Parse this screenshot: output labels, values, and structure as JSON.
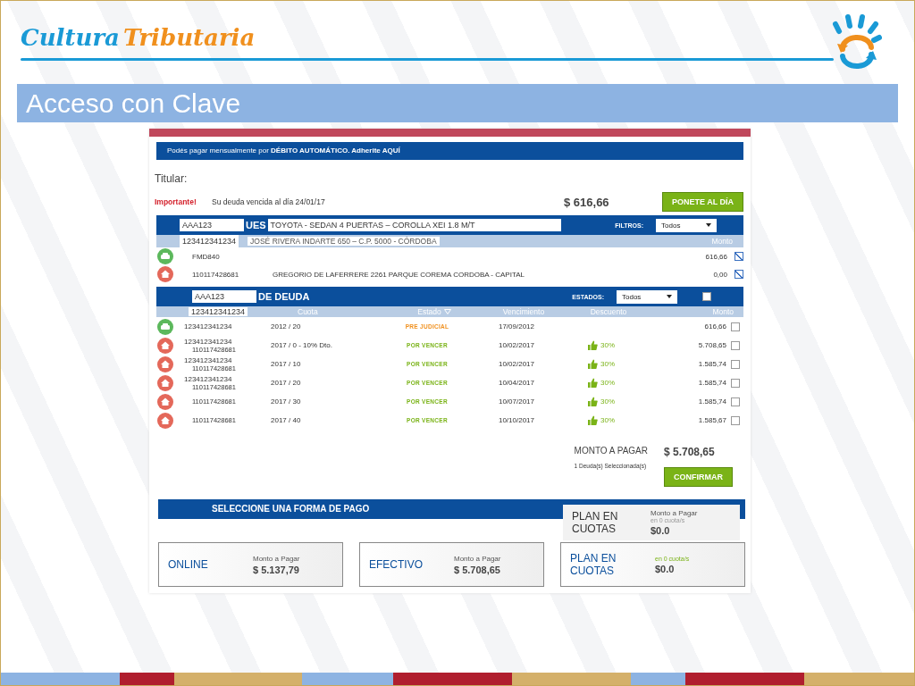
{
  "slide": {
    "brand": {
      "first": "Cultura",
      "second": "Tributaria"
    },
    "title": "Acceso con Clave"
  },
  "banner": {
    "text": "Podés pagar mensualmente por **DÉBITO AUTOMÁTICO. Adherite AQUÍ**"
  },
  "titular": {
    "label": "Titular:"
  },
  "notice": {
    "tag": "Importante!",
    "text": "Su deuda vencida al día 24/01/17",
    "amount": "$ 616,66",
    "button": "PONETE AL DÍA"
  },
  "objects": {
    "tag": "AAA123",
    "heading_fragment": "UES",
    "description": "TOYOTA -  SEDAN 4 PUERTAS – COROLLA XEI 1.8 M/T",
    "filter_label": "FILTROS:",
    "filter_value": "Todos",
    "sub_tag": "123412341234",
    "address": "JOSÉ RIVERA INDARTE 650 – C.P. 5000 - CÓRDOBA",
    "column": "Monto",
    "rows": [
      {
        "kind": "vehicle",
        "id": "FMD840",
        "amount": "616,66",
        "checked": true
      },
      {
        "kind": "property",
        "id": "110117428681",
        "address": "GREGORIO DE LAFERRERE 2261 PARQUE COREMA CORDOBA - CAPITAL",
        "amount": "0,00",
        "checked": true
      }
    ]
  },
  "debts": {
    "tag": "AAA123",
    "heading_fragment": "DE DEUDA",
    "filter_label": "ESTADOS:",
    "filter_value": "Todos",
    "all_checked": false,
    "columns": [
      "Cuota",
      "Estado",
      "Vencimiento",
      "Descuento",
      "Monto"
    ],
    "header_tag": "123412341234",
    "rows": [
      {
        "kind": "vehicle",
        "tag": "123412341234",
        "cuota": "2012 / 20",
        "estado": "PRE JUDICIAL",
        "color": "#f0901e",
        "vencimiento": "17/09/2012",
        "monto": "616,66",
        "checked": false
      },
      {
        "kind": "property",
        "tag": "123412341234",
        "id": "110117428681",
        "cuota": "2017 / 0 - 10% Dto.",
        "estado": "POR VENCER",
        "color": "#7ab317",
        "vencimiento": "10/02/2017",
        "descuento": "30%",
        "monto": "5.708,65",
        "checked": false
      },
      {
        "kind": "property",
        "tag": "123412341234",
        "id": "110117428681",
        "cuota": "2017 / 10",
        "estado": "POR VENCER",
        "color": "#7ab317",
        "vencimiento": "10/02/2017",
        "descuento": "30%",
        "monto": "1.585,74",
        "checked": false
      },
      {
        "kind": "property",
        "tag": "123412341234",
        "id": "110117428681",
        "cuota": "2017 / 20",
        "estado": "POR VENCER",
        "color": "#7ab317",
        "vencimiento": "10/04/2017",
        "descuento": "30%",
        "monto": "1.585,74",
        "checked": false
      },
      {
        "kind": "property",
        "id": "110117428681",
        "cuota": "2017 / 30",
        "estado": "POR VENCER",
        "color": "#7ab317",
        "vencimiento": "10/07/2017",
        "descuento": "30%",
        "monto": "1.585,74",
        "checked": false
      },
      {
        "kind": "property",
        "id": "110117428681",
        "cuota": "2017 / 40",
        "estado": "POR VENCER",
        "color": "#7ab317",
        "vencimiento": "10/10/2017",
        "descuento": "30%",
        "monto": "1.585,67",
        "checked": false
      }
    ]
  },
  "summary": {
    "label": "MONTO A PAGAR",
    "amount": "$ 5.708,65",
    "selected": "1 Deuda(s) Seleccionada(s)",
    "button": "CONFIRMAR"
  },
  "payment": {
    "heading": "SELECCIONE UNA FORMA DE PAGO",
    "overlay": {
      "title": "PLAN EN CUOTAS",
      "label": "Monto a Pagar",
      "note": "en 0 cuota/s",
      "amount": "$0.0"
    },
    "options": [
      {
        "title": "ONLINE",
        "label": "Monto a Pagar",
        "amount": "$ 5.137,79"
      },
      {
        "title": "EFECTIVO",
        "label": "Monto a Pagar",
        "amount": "$ 5.708,65"
      },
      {
        "title": "PLAN EN CUOTAS",
        "note": "en 0 cuota/s",
        "amount": "$0.0"
      }
    ]
  }
}
